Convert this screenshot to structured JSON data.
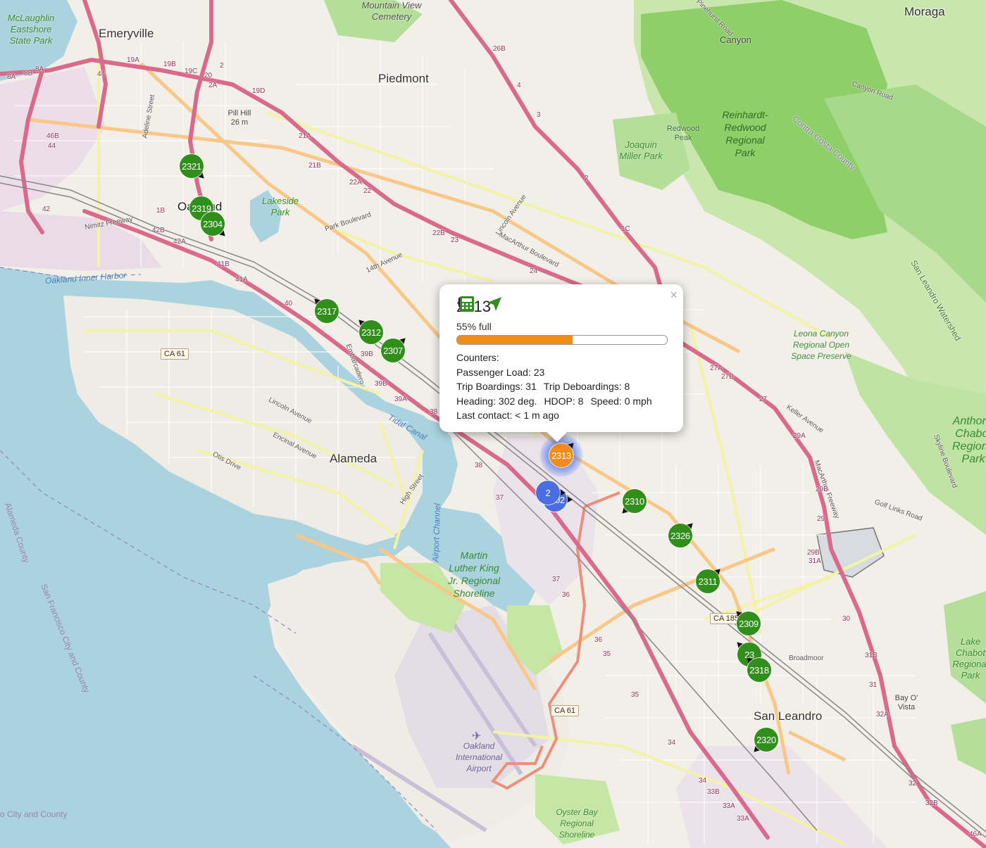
{
  "map": {
    "places": [
      {
        "name": "Emeryville"
      },
      {
        "name": "Piedmont"
      },
      {
        "name": "Oakland"
      },
      {
        "name": "Alameda"
      },
      {
        "name": "San Leandro"
      },
      {
        "name": "Moraga"
      },
      {
        "name": "Canyon"
      }
    ],
    "parks": [
      {
        "name": "McLaughlin Eastshore State Park"
      },
      {
        "name": "Mountain View Cemetery"
      },
      {
        "name": "Lakeside Park"
      },
      {
        "name": "Joaquin Miller Park"
      },
      {
        "name": "Reinhardt-Redwood Regional Park"
      },
      {
        "name": "Redwood Peak"
      },
      {
        "name": "Leona Canyon Regional Open Space Preserve"
      },
      {
        "name": "Martin Luther King Jr. Regional Shoreline"
      },
      {
        "name": "Oyster Bay Regional Shoreline"
      },
      {
        "name": "Anthony Chabot Regional Park"
      },
      {
        "name": "Lake Chabot Regional Park"
      },
      {
        "name": "Pill Hill 26 m"
      }
    ],
    "roads": [
      {
        "name": "Park Boulevard"
      },
      {
        "name": "14th Avenue"
      },
      {
        "name": "Lincoln Avenue"
      },
      {
        "name": "MacArthur Boulevard"
      },
      {
        "name": "Lincoln Avenue"
      },
      {
        "name": "Encinal Avenue"
      },
      {
        "name": "Otis Drive"
      },
      {
        "name": "High Street"
      },
      {
        "name": "Nimitz Freeway"
      },
      {
        "name": "Pinehurst Road"
      },
      {
        "name": "Canyon Road"
      },
      {
        "name": "Contra Costa County"
      },
      {
        "name": "Keller Avenue"
      },
      {
        "name": "MacArthur Freeway"
      },
      {
        "name": "Golf Links Road"
      },
      {
        "name": "Skyline Boulevard"
      },
      {
        "name": "San Leandro Watershed"
      },
      {
        "name": "Broadmoor"
      },
      {
        "name": "Adeline Street"
      },
      {
        "name": "Embarcadero"
      },
      {
        "name": "Bay O' Vista"
      }
    ],
    "shields": [
      "CA 61",
      "CA 61",
      "CA 185"
    ],
    "water_labels": [
      "Oakland Inner Harbor",
      "Tidal Canal",
      "Airport Channel"
    ],
    "county_labels": [
      "Alameda County",
      "San Francisco City and County",
      "o City and County"
    ],
    "airport": "Oakland International Airport",
    "exits": [
      "8A",
      "8B",
      "8A",
      "19A",
      "19B",
      "19C",
      "20",
      "2A",
      "2",
      "19D",
      "21A",
      "21B",
      "22A",
      "22",
      "22B",
      "23",
      "24",
      "1B",
      "42B",
      "42A",
      "41B",
      "41A",
      "40",
      "39B",
      "39B",
      "39A",
      "38",
      "38",
      "37",
      "37",
      "36",
      "36",
      "35",
      "35",
      "34",
      "34",
      "33B",
      "33A",
      "33A",
      "1C",
      "2",
      "3",
      "4",
      "26B",
      "27A",
      "27B",
      "27",
      "29A",
      "29B",
      "29",
      "29B",
      "31A",
      "30",
      "31B",
      "31",
      "32A",
      "32",
      "32B",
      "46A",
      "46B",
      "44",
      "44",
      "42"
    ],
    "colors": {
      "land": "#f2efe9",
      "water": "#aad3df",
      "park": "#b5de9a",
      "forest": "#8ccf6a",
      "motorway": "#e892a2",
      "trunk": "#f9b29c",
      "primary": "#fcd6a4",
      "secondary": "#f7fabf"
    }
  },
  "vehicles": [
    {
      "id": "2321",
      "color": "#2f8f1a"
    },
    {
      "id": "2319",
      "color": "#2f8f1a"
    },
    {
      "id": "2304",
      "color": "#2f8f1a"
    },
    {
      "id": "2317",
      "color": "#2f8f1a"
    },
    {
      "id": "2312",
      "color": "#2f8f1a"
    },
    {
      "id": "2307",
      "color": "#2f8f1a"
    },
    {
      "id": "2313",
      "color": "#f08c1a",
      "selected": true
    },
    {
      "id": "2302",
      "color": "#4a6ee0"
    },
    {
      "id": "2",
      "color": "#4a6ee0"
    },
    {
      "id": "2310",
      "color": "#2f8f1a"
    },
    {
      "id": "2326",
      "color": "#2f8f1a"
    },
    {
      "id": "2311",
      "color": "#2f8f1a"
    },
    {
      "id": "2309",
      "color": "#2f8f1a"
    },
    {
      "id": "23",
      "color": "#2f8f1a"
    },
    {
      "id": "2318",
      "color": "#2f8f1a"
    },
    {
      "id": "2320",
      "color": "#2f8f1a"
    }
  ],
  "popup": {
    "vehicle_id": "2313",
    "fullness_text": "55% full",
    "fullness_fraction": 0.55,
    "bus_icon": "bus-icon",
    "locate_icon": "location-arrow-icon",
    "calc_icon": "calculator-icon",
    "close": "×",
    "counters_label": "Counters:",
    "passenger_load": "Passenger Load: 23",
    "trip_boardings": "Trip Boardings: 31",
    "trip_deboardings": "Trip Deboardings: 8",
    "heading": "Heading: 302 deg.",
    "hdop": "HDOP: 8",
    "speed": "Speed: 0 mph",
    "last_contact": "Last contact: < 1 m ago"
  }
}
